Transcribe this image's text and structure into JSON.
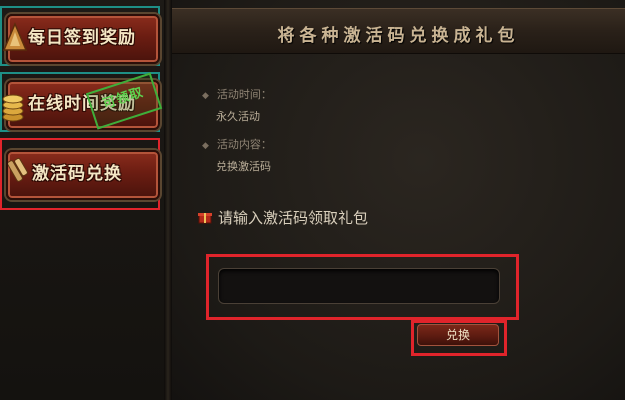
{
  "sidebar": {
    "items": [
      {
        "label": "每日签到奖励",
        "icon": "sign-in-scroll-icon"
      },
      {
        "label": "在线时间奖励",
        "icon": "gold-coins-icon",
        "badge": "可领取"
      },
      {
        "label": "激活码兑换",
        "icon": "key-scroll-icon"
      }
    ]
  },
  "main": {
    "title": "将各种激活码兑换成礼包",
    "activity_time_label": "活动时间：",
    "activity_time_value": "永久活动",
    "activity_content_label": "活动内容：",
    "activity_content_value": "兑换激活码",
    "prompt": "请输入激活码领取礼包",
    "code_input": {
      "value": "",
      "placeholder": ""
    },
    "redeem_label": "兑换"
  },
  "colors": {
    "accent_red": "#e0242b",
    "accent_teal": "#1e8f86",
    "title_gold": "#c9b493"
  }
}
